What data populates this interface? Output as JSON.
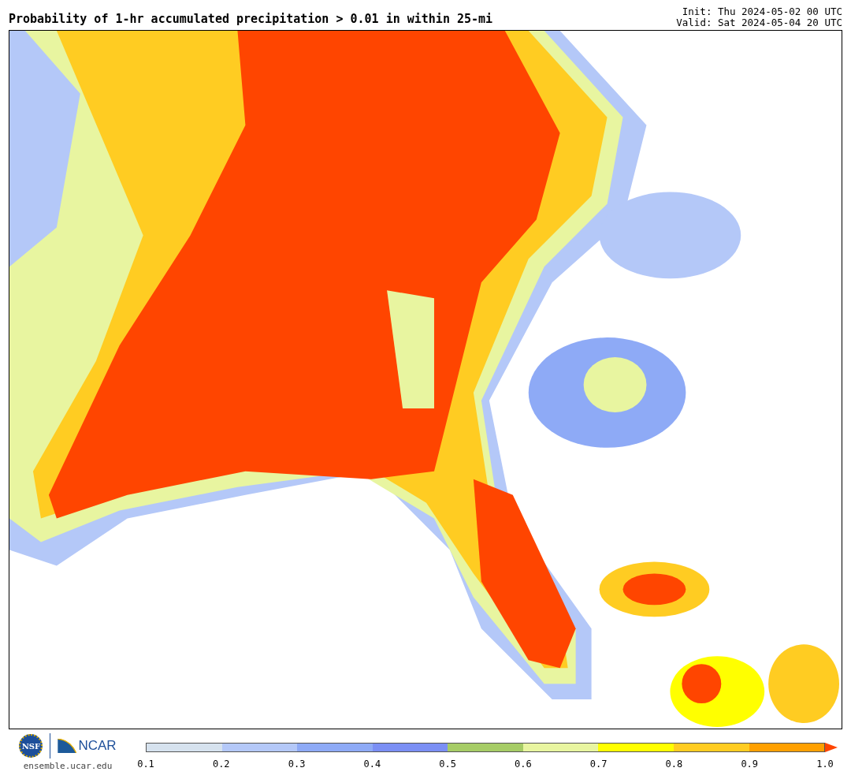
{
  "title": "Probability of 1-hr accumulated precipitation > 0.01 in within 25-mi",
  "init": "Init: Thu 2024-05-02 00 UTC",
  "valid": "Valid: Sat 2024-05-04 20 UTC",
  "logos": {
    "nsf": "NSF",
    "ncar": "NCAR",
    "site": "ensemble.ucar.edu"
  },
  "colorbar": {
    "segments": [
      {
        "color": "#d6e2ee"
      },
      {
        "color": "#b4c8f8"
      },
      {
        "color": "#8eaaf6"
      },
      {
        "color": "#7b8ff4"
      },
      {
        "color": "#a6cc66"
      },
      {
        "color": "#e8f5a0"
      },
      {
        "color": "#ffff00"
      },
      {
        "color": "#ffcc22"
      },
      {
        "color": "#ffa000"
      }
    ],
    "extension": {
      "kind": "arrow",
      "color": "#ff4500"
    },
    "ticks": [
      "0.1",
      "0.2",
      "0.3",
      "0.4",
      "0.5",
      "0.6",
      "0.7",
      "0.8",
      "0.9",
      "1.0"
    ]
  }
}
